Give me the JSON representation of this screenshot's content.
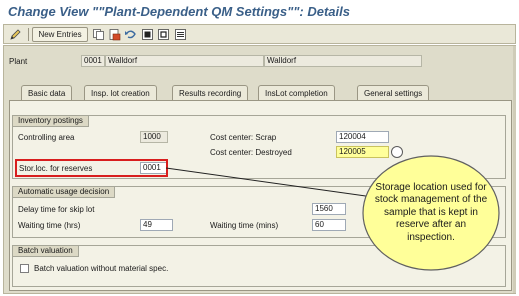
{
  "title": "Change View \"\"Plant-Dependent QM Settings\"\": Details",
  "toolbar": {
    "new_entries_label": "New Entries",
    "icons": [
      "edit-pencil-icon",
      "copy-icon",
      "delete-icon",
      "undo-icon",
      "previous-entry-icon",
      "next-entry-icon",
      "select-all-icon"
    ]
  },
  "plant": {
    "label": "Plant",
    "code": "0001",
    "name": "Walldorf",
    "city": "Walldorf"
  },
  "tabs": [
    {
      "label": "Basic data",
      "active": false
    },
    {
      "label": "Insp. lot creation",
      "active": false
    },
    {
      "label": "Results recording",
      "active": false
    },
    {
      "label": "InsLot completion",
      "active": true
    },
    {
      "label": "General settings",
      "active": false
    }
  ],
  "inventory": {
    "title": "Inventory postings",
    "controlling_area_label": "Controlling area",
    "controlling_area_value": "1000",
    "cc_scrap_label": "Cost center: Scrap",
    "cc_scrap_value": "120004",
    "cc_destroyed_label": "Cost center: Destroyed",
    "cc_destroyed_value": "120005",
    "stor_loc_label": "Stor.loc. for reserves",
    "stor_loc_value": "0001"
  },
  "usage": {
    "title": "Automatic usage decision",
    "delay_label": "Delay time for skip lot",
    "delay_value": "1560",
    "waiting_hrs_label": "Waiting time (hrs)",
    "waiting_hrs_value": "49",
    "waiting_mins_label": "Waiting time (mins)",
    "waiting_mins_value": "60"
  },
  "batch": {
    "title": "Batch valuation",
    "checkbox_label": "Batch valuation without material spec.",
    "checked": false
  },
  "callout": {
    "text": "Storage location used for stock management of the sample that is kept in reserve after an inspection."
  },
  "colors": {
    "title": "#3a5f88",
    "highlight": "#d81e1e",
    "callout_fill": "#ffff99",
    "required_field": "#ffff9a"
  }
}
